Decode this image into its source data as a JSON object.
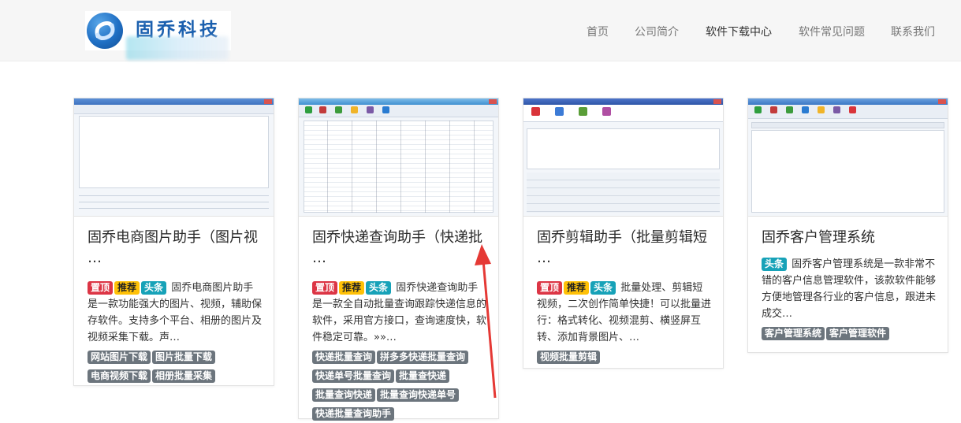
{
  "brand": {
    "name": "固乔科技"
  },
  "nav": {
    "items": [
      {
        "label": "首页"
      },
      {
        "label": "公司简介"
      },
      {
        "label": "软件下载中心",
        "active": true
      },
      {
        "label": "软件常见问题"
      },
      {
        "label": "联系我们"
      }
    ]
  },
  "colors": {
    "badge_top": "#dc3545",
    "badge_recommend": "#ffc107",
    "badge_headline": "#17a2b8",
    "tag": "#6c757d",
    "annotation_arrow": "#e53935"
  },
  "cards": [
    {
      "title": "固乔电商图片助手（图片视\n…",
      "badges": [
        "置顶",
        "推荐",
        "头条"
      ],
      "desc": "固乔电商图片助手是一款功能强大的图片、视频，辅助保存软件。支持多个平台、相册的图片及视频采集下载。声…",
      "tags": [
        "网站图片下载",
        "图片批量下载",
        "电商视频下载",
        "相册批量采集"
      ]
    },
    {
      "title": "固乔快递查询助手（快递批\n…",
      "badges": [
        "置顶",
        "推荐",
        "头条"
      ],
      "desc": "固乔快递查询助手是一款全自动批量查询跟踪快递信息的软件，采用官方接口，查询速度快，软件稳定可靠。»»…",
      "tags": [
        "快递批量查询",
        "拼多多快递批量查询",
        "快递单号批量查询",
        "批量查快递",
        "批量查询快递",
        "批量查询快递单号",
        "快递批量查询助手"
      ]
    },
    {
      "title": "固乔剪辑助手（批量剪辑短\n…",
      "badges": [
        "置顶",
        "推荐",
        "头条"
      ],
      "desc": "批量处理、剪辑短视频，二次创作简单快捷！可以批量进行：格式转化、视频混剪、横竖屏互转、添加背景图片、…",
      "tags": [
        "视频批量剪辑"
      ]
    },
    {
      "title": "固乔客户管理系统",
      "badges": [
        "头条"
      ],
      "desc": "固乔客户管理系统是一款非常不错的客户信息管理软件，该款软件能够方便地管理各行业的客户信息，跟进未成交…",
      "tags": [
        "客户管理系统",
        "客户管理软件"
      ]
    }
  ]
}
